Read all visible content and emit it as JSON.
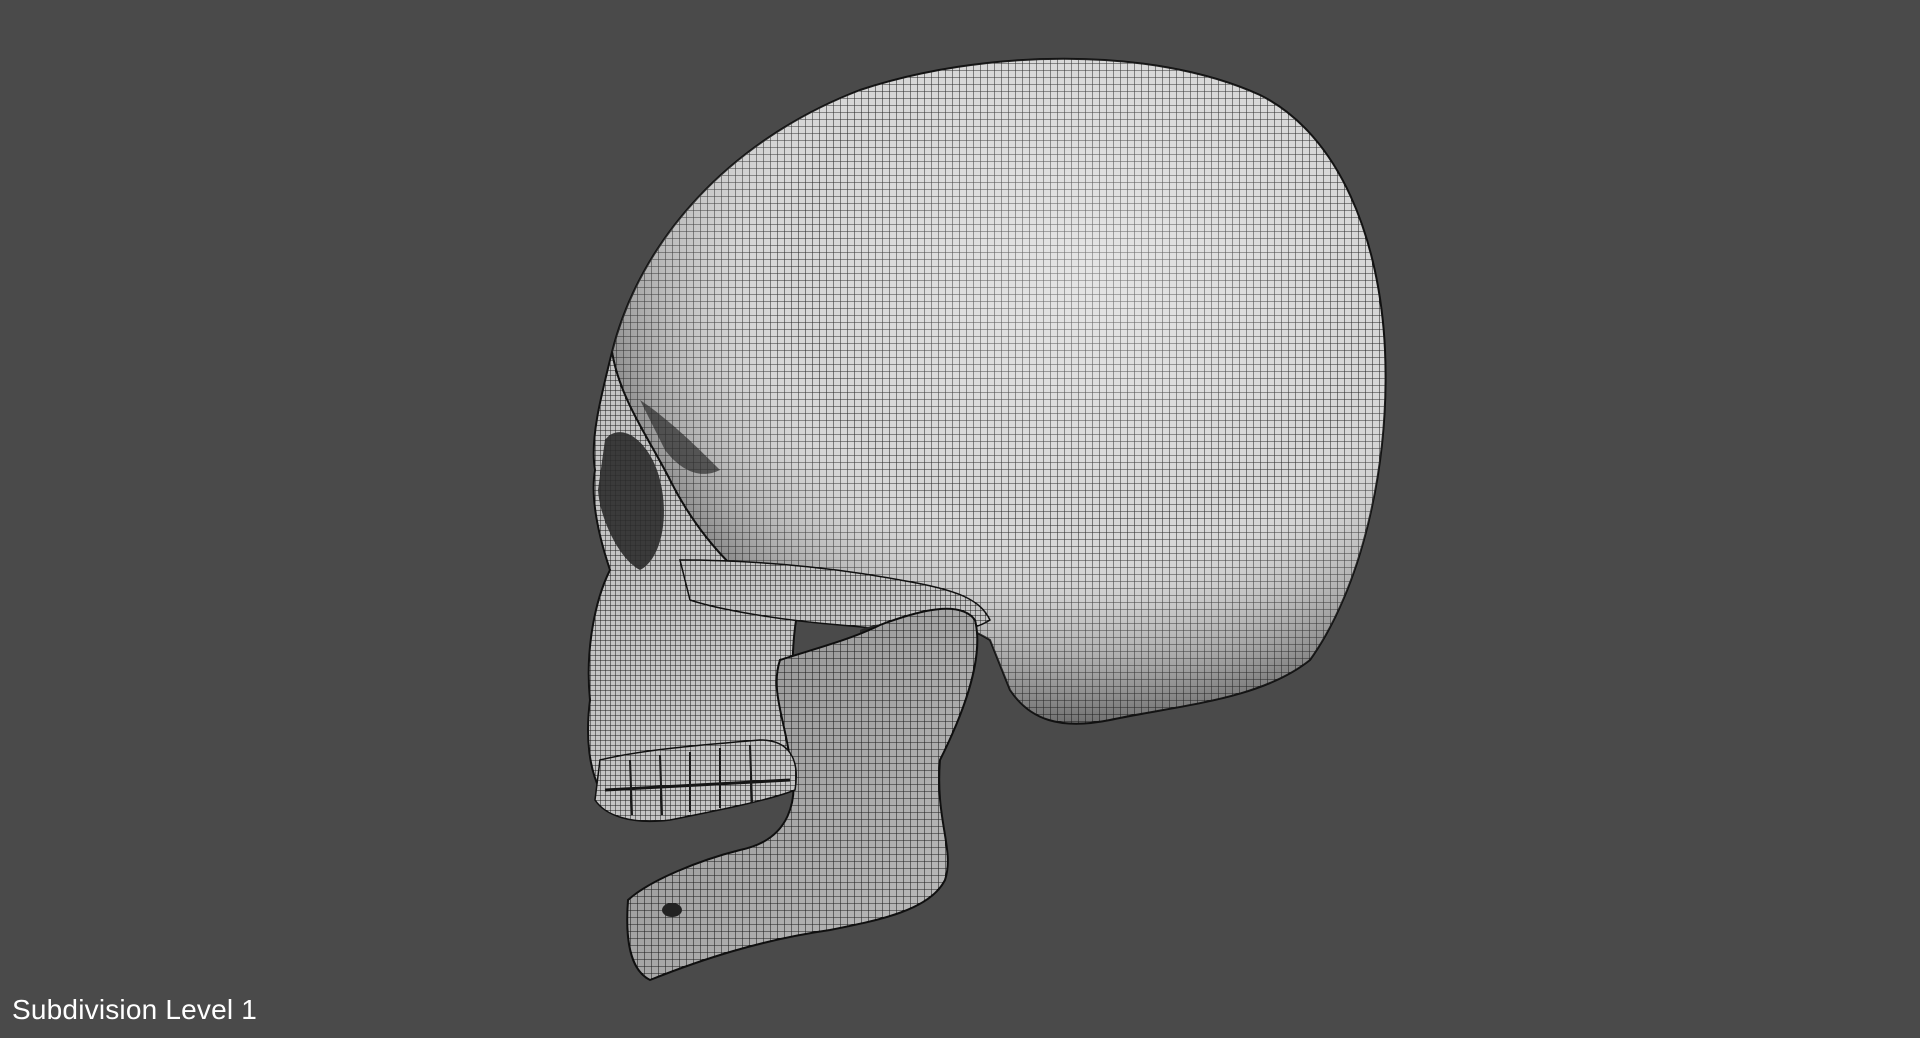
{
  "viewport": {
    "background_color": "#4a4a4a",
    "label": "Subdivision Level 1"
  },
  "model": {
    "subject": "skull-wireframe",
    "surface_color": "#d9d9d9",
    "wire_color": "#1e1e1e"
  }
}
